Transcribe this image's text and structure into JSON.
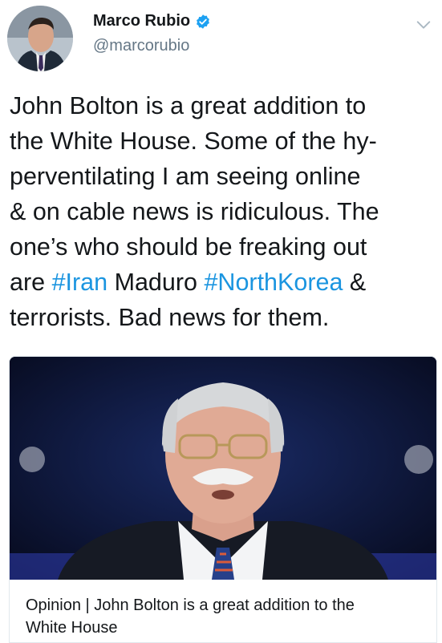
{
  "tweet": {
    "author": {
      "name": "Marco Rubio",
      "handle": "@marcorubio"
    },
    "text_lines": [
      [
        {
          "t": "John Bolton is a great addition to"
        }
      ],
      [
        {
          "t": "the White House. Some of the hy-"
        }
      ],
      [
        {
          "t": "perventilating I am seeing online"
        }
      ],
      [
        {
          "t": "& on cable news is ridiculous. The"
        }
      ],
      [
        {
          "t": "one’s who should be freaking out"
        }
      ],
      [
        {
          "t": "are "
        },
        {
          "t": "#Iran",
          "tag": true
        },
        {
          "t": " Maduro "
        },
        {
          "t": "#NorthKorea",
          "tag": true
        },
        {
          "t": " &"
        }
      ],
      [
        {
          "t": "terrorists. Bad news for them."
        }
      ]
    ],
    "card": {
      "title_lines": [
        "Opinion | John Bolton is a great addition to the",
        "White House"
      ]
    }
  },
  "colors": {
    "hashtag": "#1b95e0",
    "verified": "#1da1f2",
    "secondary_text": "#657786"
  },
  "icons": {
    "verified": "verified-badge-icon",
    "menu": "chevron-down-icon"
  }
}
